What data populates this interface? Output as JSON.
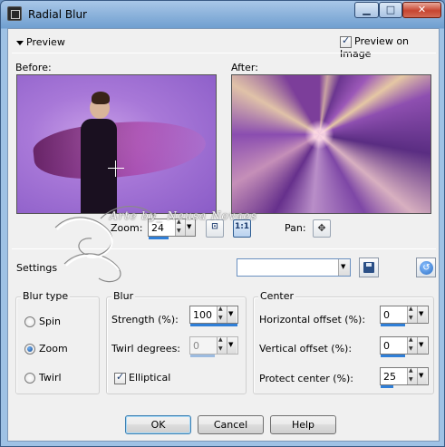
{
  "window": {
    "title": "Radial Blur",
    "controls": {
      "minimize": "▁",
      "maximize": "□",
      "close": "✕"
    }
  },
  "preview": {
    "toggle_label": "Preview",
    "preview_on_image_label": "Preview on Image",
    "preview_on_image_checked": true,
    "before_label": "Before:",
    "after_label": "After:"
  },
  "zoom": {
    "label": "Zoom:",
    "value": "24",
    "fit_icon": "fit-window-icon",
    "actual_size_label": "1:1",
    "pan_label": "Pan:",
    "pan_icon": "move-cross-icon"
  },
  "watermark": {
    "text": "Arte by_ Neusa Novaes"
  },
  "settings": {
    "label": "Settings",
    "preset_value": "",
    "save_icon": "save-disk-icon",
    "reset_icon": "reset-icon"
  },
  "blur_type": {
    "title": "Blur type",
    "options": [
      {
        "label": "Spin",
        "selected": false
      },
      {
        "label": "Zoom",
        "selected": true
      },
      {
        "label": "Twirl",
        "selected": false
      }
    ]
  },
  "blur": {
    "title": "Blur",
    "strength_label": "Strength (%):",
    "strength_value": "100",
    "twirl_label": "Twirl degrees:",
    "twirl_value": "0",
    "elliptical_label": "Elliptical",
    "elliptical_checked": true
  },
  "center": {
    "title": "Center",
    "horizontal_label": "Horizontal offset (%):",
    "horizontal_value": "0",
    "vertical_label": "Vertical offset (%):",
    "vertical_value": "0",
    "protect_label": "Protect center (%):",
    "protect_value": "25"
  },
  "buttons": {
    "ok": "OK",
    "cancel": "Cancel",
    "help": "Help"
  },
  "colors": {
    "accent_bar": "#2f7fd8",
    "title_gradient": "#8eb4dc",
    "close_button": "#c74530"
  }
}
